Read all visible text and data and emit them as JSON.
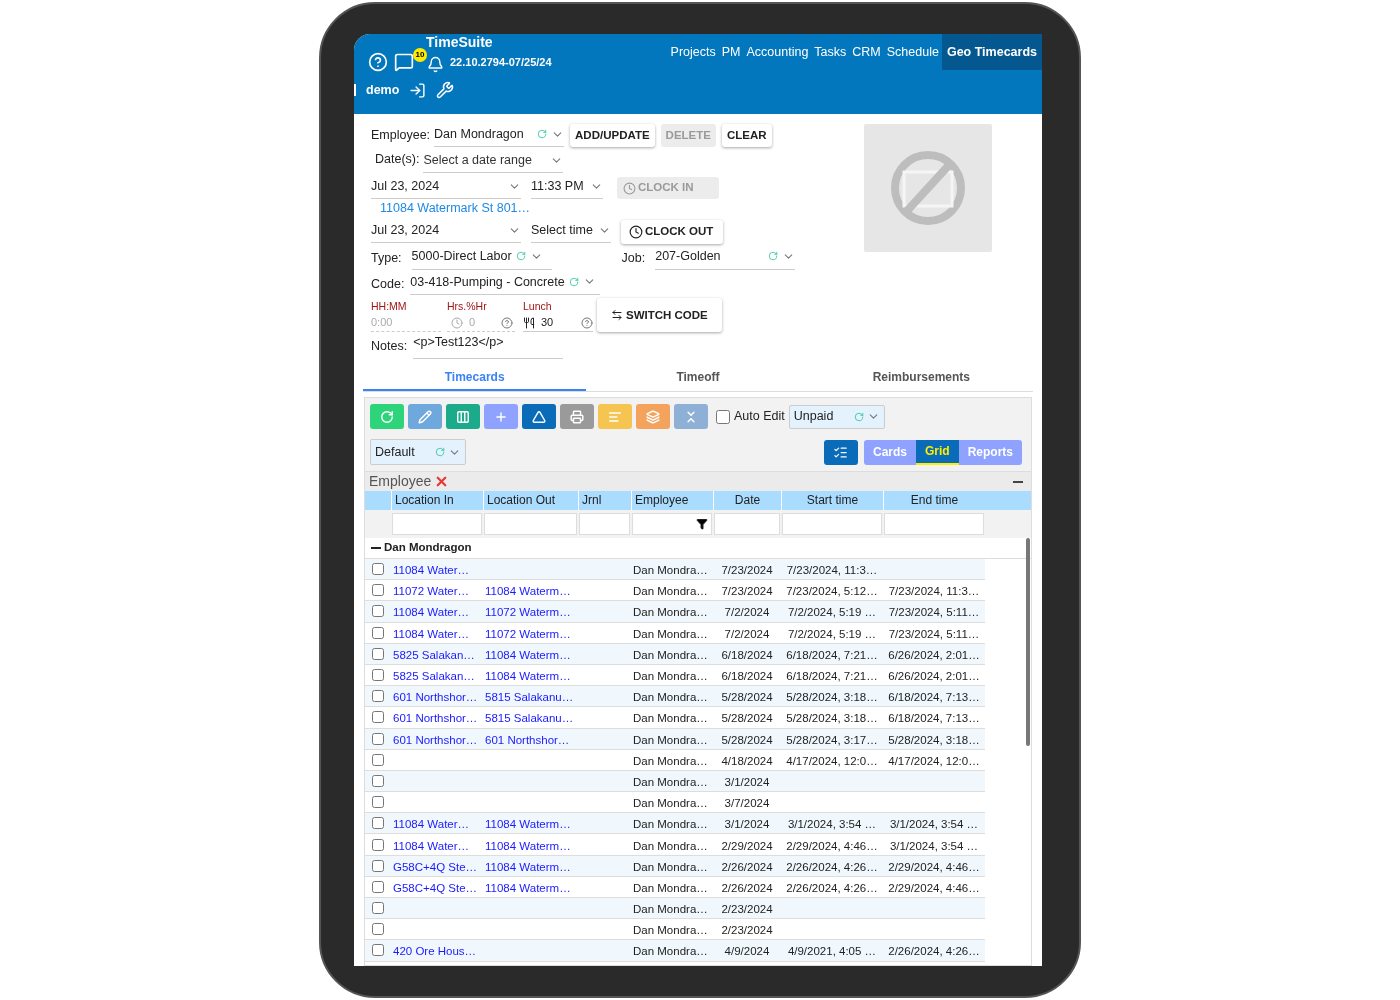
{
  "header": {
    "title": "TimeSuite",
    "notification_count": "10",
    "version": "22.10.2794-07/25/24",
    "user": "demo",
    "nav": [
      {
        "label": "Projects",
        "selected": false
      },
      {
        "label": "PM",
        "selected": false
      },
      {
        "label": "Accounting",
        "selected": false
      },
      {
        "label": "Tasks",
        "selected": false
      },
      {
        "label": "CRM",
        "selected": false
      },
      {
        "label": "Schedule",
        "selected": false
      },
      {
        "label": "Geo Timecards",
        "selected": true
      }
    ]
  },
  "form": {
    "employee": {
      "label": "Employee:",
      "value": "Dan Mondragon"
    },
    "buttons": [
      {
        "label": "ADD/UPDATE",
        "disabled": false
      },
      {
        "label": "DELETE",
        "disabled": true
      },
      {
        "label": "CLEAR",
        "disabled": false
      }
    ],
    "dates": {
      "label": "Date(s):",
      "placeholder": "Select a date range"
    },
    "clock_in": {
      "date": "Jul 23, 2024",
      "time": "11:33 PM",
      "button": "CLOCK IN",
      "disabled": true,
      "location": "11084 Watermark St 801…"
    },
    "clock_out": {
      "date": "Jul 23, 2024",
      "time_placeholder": "Select time",
      "button": "CLOCK OUT",
      "disabled": false
    },
    "type": {
      "label": "Type:",
      "value": "5000-Direct Labor"
    },
    "job": {
      "label": "Job:",
      "value": "207-Golden"
    },
    "code": {
      "label": "Code:",
      "value": "03-418-Pumping - Concrete"
    },
    "hours": {
      "label": "HH:MM",
      "placeholder": "0:00"
    },
    "hrs_pct": {
      "label": "Hrs.%Hr",
      "placeholder": "0"
    },
    "lunch": {
      "label": "Lunch",
      "value": "30"
    },
    "switch_code": "SWITCH CODE",
    "notes": {
      "label": "Notes:",
      "value": "<p>Test123</p>"
    }
  },
  "tabs": [
    {
      "label": "Timecards",
      "selected": true
    },
    {
      "label": "Timeoff",
      "selected": false
    },
    {
      "label": "Reimbursements",
      "selected": false
    }
  ],
  "toolbar": {
    "tools": [
      {
        "kind": "refresh",
        "color": "#2ed47a"
      },
      {
        "kind": "edit",
        "color": "#6fa8dc"
      },
      {
        "kind": "columns",
        "color": "#1bab8a"
      },
      {
        "kind": "add",
        "color": "#8fa2ff"
      },
      {
        "kind": "ruler",
        "color": "#0a6bb8"
      },
      {
        "kind": "print",
        "color": "#9a9a9a"
      },
      {
        "kind": "sort",
        "color": "#f5c451"
      },
      {
        "kind": "layers",
        "color": "#f3a35c"
      },
      {
        "kind": "collapse",
        "color": "#8fb0d6"
      }
    ],
    "auto_edit": {
      "label": "Auto Edit",
      "checked": false
    },
    "pay_filter": "Unpaid",
    "layout": "Default",
    "views": [
      {
        "label": "Cards",
        "selected": false
      },
      {
        "label": "Grid",
        "selected": true
      },
      {
        "label": "Reports",
        "selected": false
      }
    ]
  },
  "grid": {
    "group_by": "Employee",
    "columns": [
      "Location In",
      "Location Out",
      "Jrnl",
      "Employee",
      "Date",
      "Start time",
      "End time"
    ],
    "group": "Dan Mondragon",
    "rows": [
      {
        "checked": false,
        "cells": [
          "11084 Water…",
          "",
          "",
          "Dan Mondra…",
          "7/23/2024",
          "7/23/2024, 11:3…",
          ""
        ]
      },
      {
        "checked": false,
        "cells": [
          "11072 Water…",
          "11084 Waterm…",
          "",
          "Dan Mondra…",
          "7/23/2024",
          "7/23/2024, 5:12…",
          "7/23/2024, 11:3…"
        ]
      },
      {
        "checked": false,
        "cells": [
          "11084 Water…",
          "11072 Waterm…",
          "",
          "Dan Mondra…",
          "7/2/2024",
          "7/2/2024, 5:19 …",
          "7/23/2024, 5:11…"
        ]
      },
      {
        "checked": false,
        "cells": [
          "11084 Water…",
          "11072 Waterm…",
          "",
          "Dan Mondra…",
          "7/2/2024",
          "7/2/2024, 5:19 …",
          "7/23/2024, 5:11…"
        ]
      },
      {
        "checked": false,
        "cells": [
          "5825 Salakan…",
          "11084 Waterm…",
          "",
          "Dan Mondra…",
          "6/18/2024",
          "6/18/2024, 7:21…",
          "6/26/2024, 2:01…"
        ]
      },
      {
        "checked": false,
        "cells": [
          "5825 Salakan…",
          "11084 Waterm…",
          "",
          "Dan Mondra…",
          "6/18/2024",
          "6/18/2024, 7:21…",
          "6/26/2024, 2:01…"
        ]
      },
      {
        "checked": false,
        "cells": [
          "601 Northshor…",
          "5815 Salakanu…",
          "",
          "Dan Mondra…",
          "5/28/2024",
          "5/28/2024, 3:18…",
          "6/18/2024, 7:13…"
        ]
      },
      {
        "checked": false,
        "cells": [
          "601 Northshor…",
          "5815 Salakanu…",
          "",
          "Dan Mondra…",
          "5/28/2024",
          "5/28/2024, 3:18…",
          "6/18/2024, 7:13…"
        ]
      },
      {
        "checked": false,
        "cells": [
          "601 Northshor…",
          "601 Northshor…",
          "",
          "Dan Mondra…",
          "5/28/2024",
          "5/28/2024, 3:17…",
          "5/28/2024, 3:18…"
        ]
      },
      {
        "checked": false,
        "cells": [
          "",
          "",
          "",
          "Dan Mondra…",
          "4/18/2024",
          "4/17/2024, 12:0…",
          "4/17/2024, 12:0…"
        ]
      },
      {
        "checked": false,
        "cells": [
          "",
          "",
          "",
          "Dan Mondra…",
          "3/1/2024",
          "",
          ""
        ]
      },
      {
        "checked": false,
        "cells": [
          "",
          "",
          "",
          "Dan Mondra…",
          "3/7/2024",
          "",
          ""
        ]
      },
      {
        "checked": false,
        "cells": [
          "11084 Water…",
          "11084 Waterm…",
          "",
          "Dan Mondra…",
          "3/1/2024",
          "3/1/2024, 3:54 …",
          "3/1/2024, 3:54 …"
        ]
      },
      {
        "checked": false,
        "cells": [
          "11084 Water…",
          "11084 Waterm…",
          "",
          "Dan Mondra…",
          "2/29/2024",
          "2/29/2024, 4:46…",
          "3/1/2024, 3:54 …"
        ]
      },
      {
        "checked": false,
        "cells": [
          "G58C+4Q Ste…",
          "11084 Waterm…",
          "",
          "Dan Mondra…",
          "2/26/2024",
          "2/26/2024, 4:26…",
          "2/29/2024, 4:46…"
        ]
      },
      {
        "checked": false,
        "cells": [
          "G58C+4Q Ste…",
          "11084 Waterm…",
          "",
          "Dan Mondra…",
          "2/26/2024",
          "2/26/2024, 4:26…",
          "2/29/2024, 4:46…"
        ]
      },
      {
        "checked": false,
        "cells": [
          "",
          "",
          "",
          "Dan Mondra…",
          "2/23/2024",
          "",
          ""
        ]
      },
      {
        "checked": false,
        "cells": [
          "",
          "",
          "",
          "Dan Mondra…",
          "2/23/2024",
          "",
          ""
        ]
      },
      {
        "checked": false,
        "cells": [
          "420 Ore Hous…",
          "",
          "",
          "Dan Mondra…",
          "4/9/2024",
          "4/9/2021, 4:05 …",
          "2/26/2024, 4:26…"
        ]
      }
    ]
  }
}
